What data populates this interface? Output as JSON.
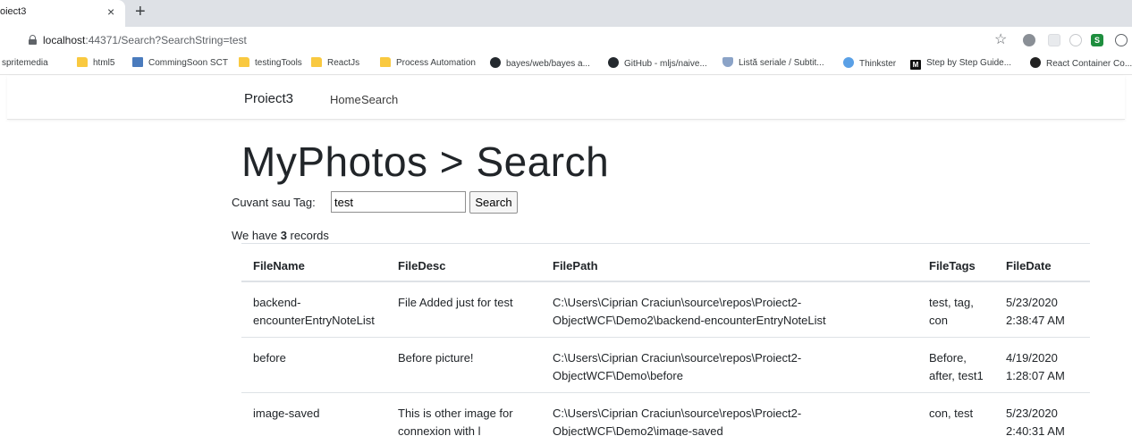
{
  "browser": {
    "tab_title": "oiect3",
    "tab_close": "×",
    "new_tab": "+",
    "url_host": "localhost",
    "url_rest": ":44371/Search?SearchString=test",
    "bookmarks": [
      {
        "label": "spritemedia",
        "icon": "none"
      },
      {
        "label": "html5",
        "icon": "folder-icon"
      },
      {
        "label": "CommingSoon SCT",
        "icon": "page-icon"
      },
      {
        "label": "testingTools",
        "icon": "folder-icon"
      },
      {
        "label": "ReactJs",
        "icon": "folder-icon"
      },
      {
        "label": "Process Automation",
        "icon": "folder-icon"
      },
      {
        "label": "bayes/web/bayes a...",
        "icon": "github-icon"
      },
      {
        "label": "GitHub - mljs/naive...",
        "icon": "github-icon"
      },
      {
        "label": "Listă seriale / Subtit...",
        "icon": "shield-icon"
      },
      {
        "label": "Thinkster",
        "icon": "thinkster-icon"
      },
      {
        "label": "Step by Step Guide...",
        "icon": "medium-icon"
      },
      {
        "label": "React Container Co...",
        "icon": "react-icon"
      }
    ]
  },
  "navbar": {
    "brand": "Proiect3",
    "links": [
      "Home",
      "Search"
    ]
  },
  "page": {
    "title": "MyPhotos > Search",
    "search_label": "Cuvant sau Tag:",
    "search_value": "test",
    "search_button": "Search",
    "records_prefix": "We have ",
    "records_count": "3",
    "records_suffix": " records"
  },
  "table": {
    "headers": [
      "FileName",
      "FileDesc",
      "FilePath",
      "FileTags",
      "FileDate"
    ],
    "rows": [
      {
        "name": [
          "backend-",
          "encounterEntryNoteList"
        ],
        "desc": [
          "File Added just for test"
        ],
        "path": [
          "C:\\Users\\Ciprian Craciun\\source\\repos\\Proiect2-",
          "ObjectWCF\\Demo2\\backend-encounterEntryNoteList"
        ],
        "tags": [
          "test, tag,",
          "con"
        ],
        "date": [
          "5/23/2020",
          "2:38:47 AM"
        ]
      },
      {
        "name": [
          "before"
        ],
        "desc": [
          "Before picture!"
        ],
        "path": [
          "C:\\Users\\Ciprian Craciun\\source\\repos\\Proiect2-",
          "ObjectWCF\\Demo\\before"
        ],
        "tags": [
          "Before,",
          "after, test1"
        ],
        "date": [
          "4/19/2020",
          "1:28:07 AM"
        ]
      },
      {
        "name": [
          "image-saved"
        ],
        "desc": [
          "This is other image for",
          "connexion with l"
        ],
        "path": [
          "C:\\Users\\Ciprian Craciun\\source\\repos\\Proiect2-",
          "ObjectWCF\\Demo2\\image-saved"
        ],
        "tags": [
          "con, test"
        ],
        "date": [
          "5/23/2020",
          "2:40:31 AM"
        ]
      }
    ]
  }
}
